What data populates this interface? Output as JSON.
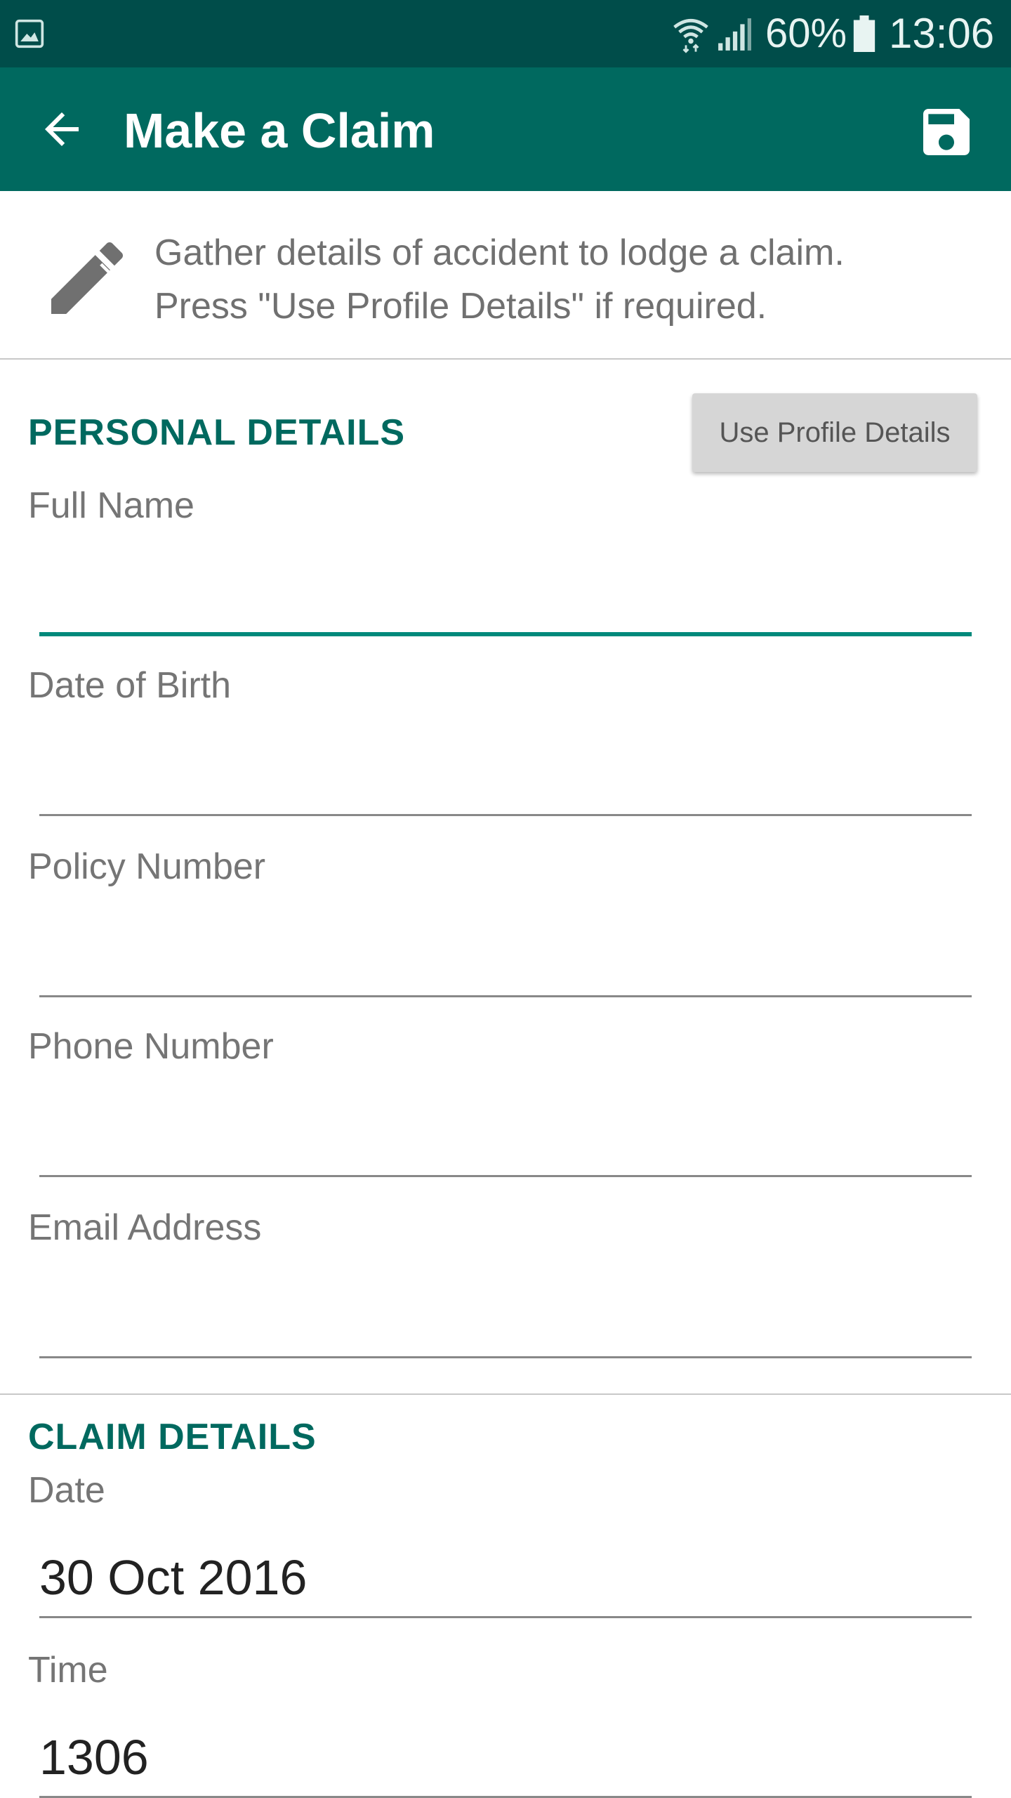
{
  "status_bar": {
    "battery": "60%",
    "time": "13:06",
    "icons": [
      "gallery-icon",
      "wifi-icon",
      "signal-icon",
      "battery-icon"
    ]
  },
  "app_bar": {
    "title": "Make a Claim",
    "back_icon": "arrow-left-icon",
    "save_icon": "floppy-disk-icon",
    "color": "#00695f"
  },
  "info": {
    "icon": "pencil-icon",
    "line1": "Gather details of accident to lodge a claim.",
    "line2": "Press \"Use Profile Details\" if required."
  },
  "personal": {
    "title": "PERSONAL DETAILS",
    "use_profile_label": "Use Profile Details",
    "fields": [
      {
        "label": "Full Name",
        "value": ""
      },
      {
        "label": "Date of Birth",
        "value": ""
      },
      {
        "label": "Policy Number",
        "value": ""
      },
      {
        "label": "Phone Number",
        "value": ""
      },
      {
        "label": "Email Address",
        "value": ""
      }
    ]
  },
  "claim": {
    "title": "CLAIM DETAILS",
    "fields": [
      {
        "label": "Date",
        "value": "30 Oct 2016"
      },
      {
        "label": "Time",
        "value": "1306"
      }
    ]
  },
  "colors": {
    "status_bar": "#004d4a",
    "accent": "#00695f",
    "focus_underline": "#00897b"
  }
}
